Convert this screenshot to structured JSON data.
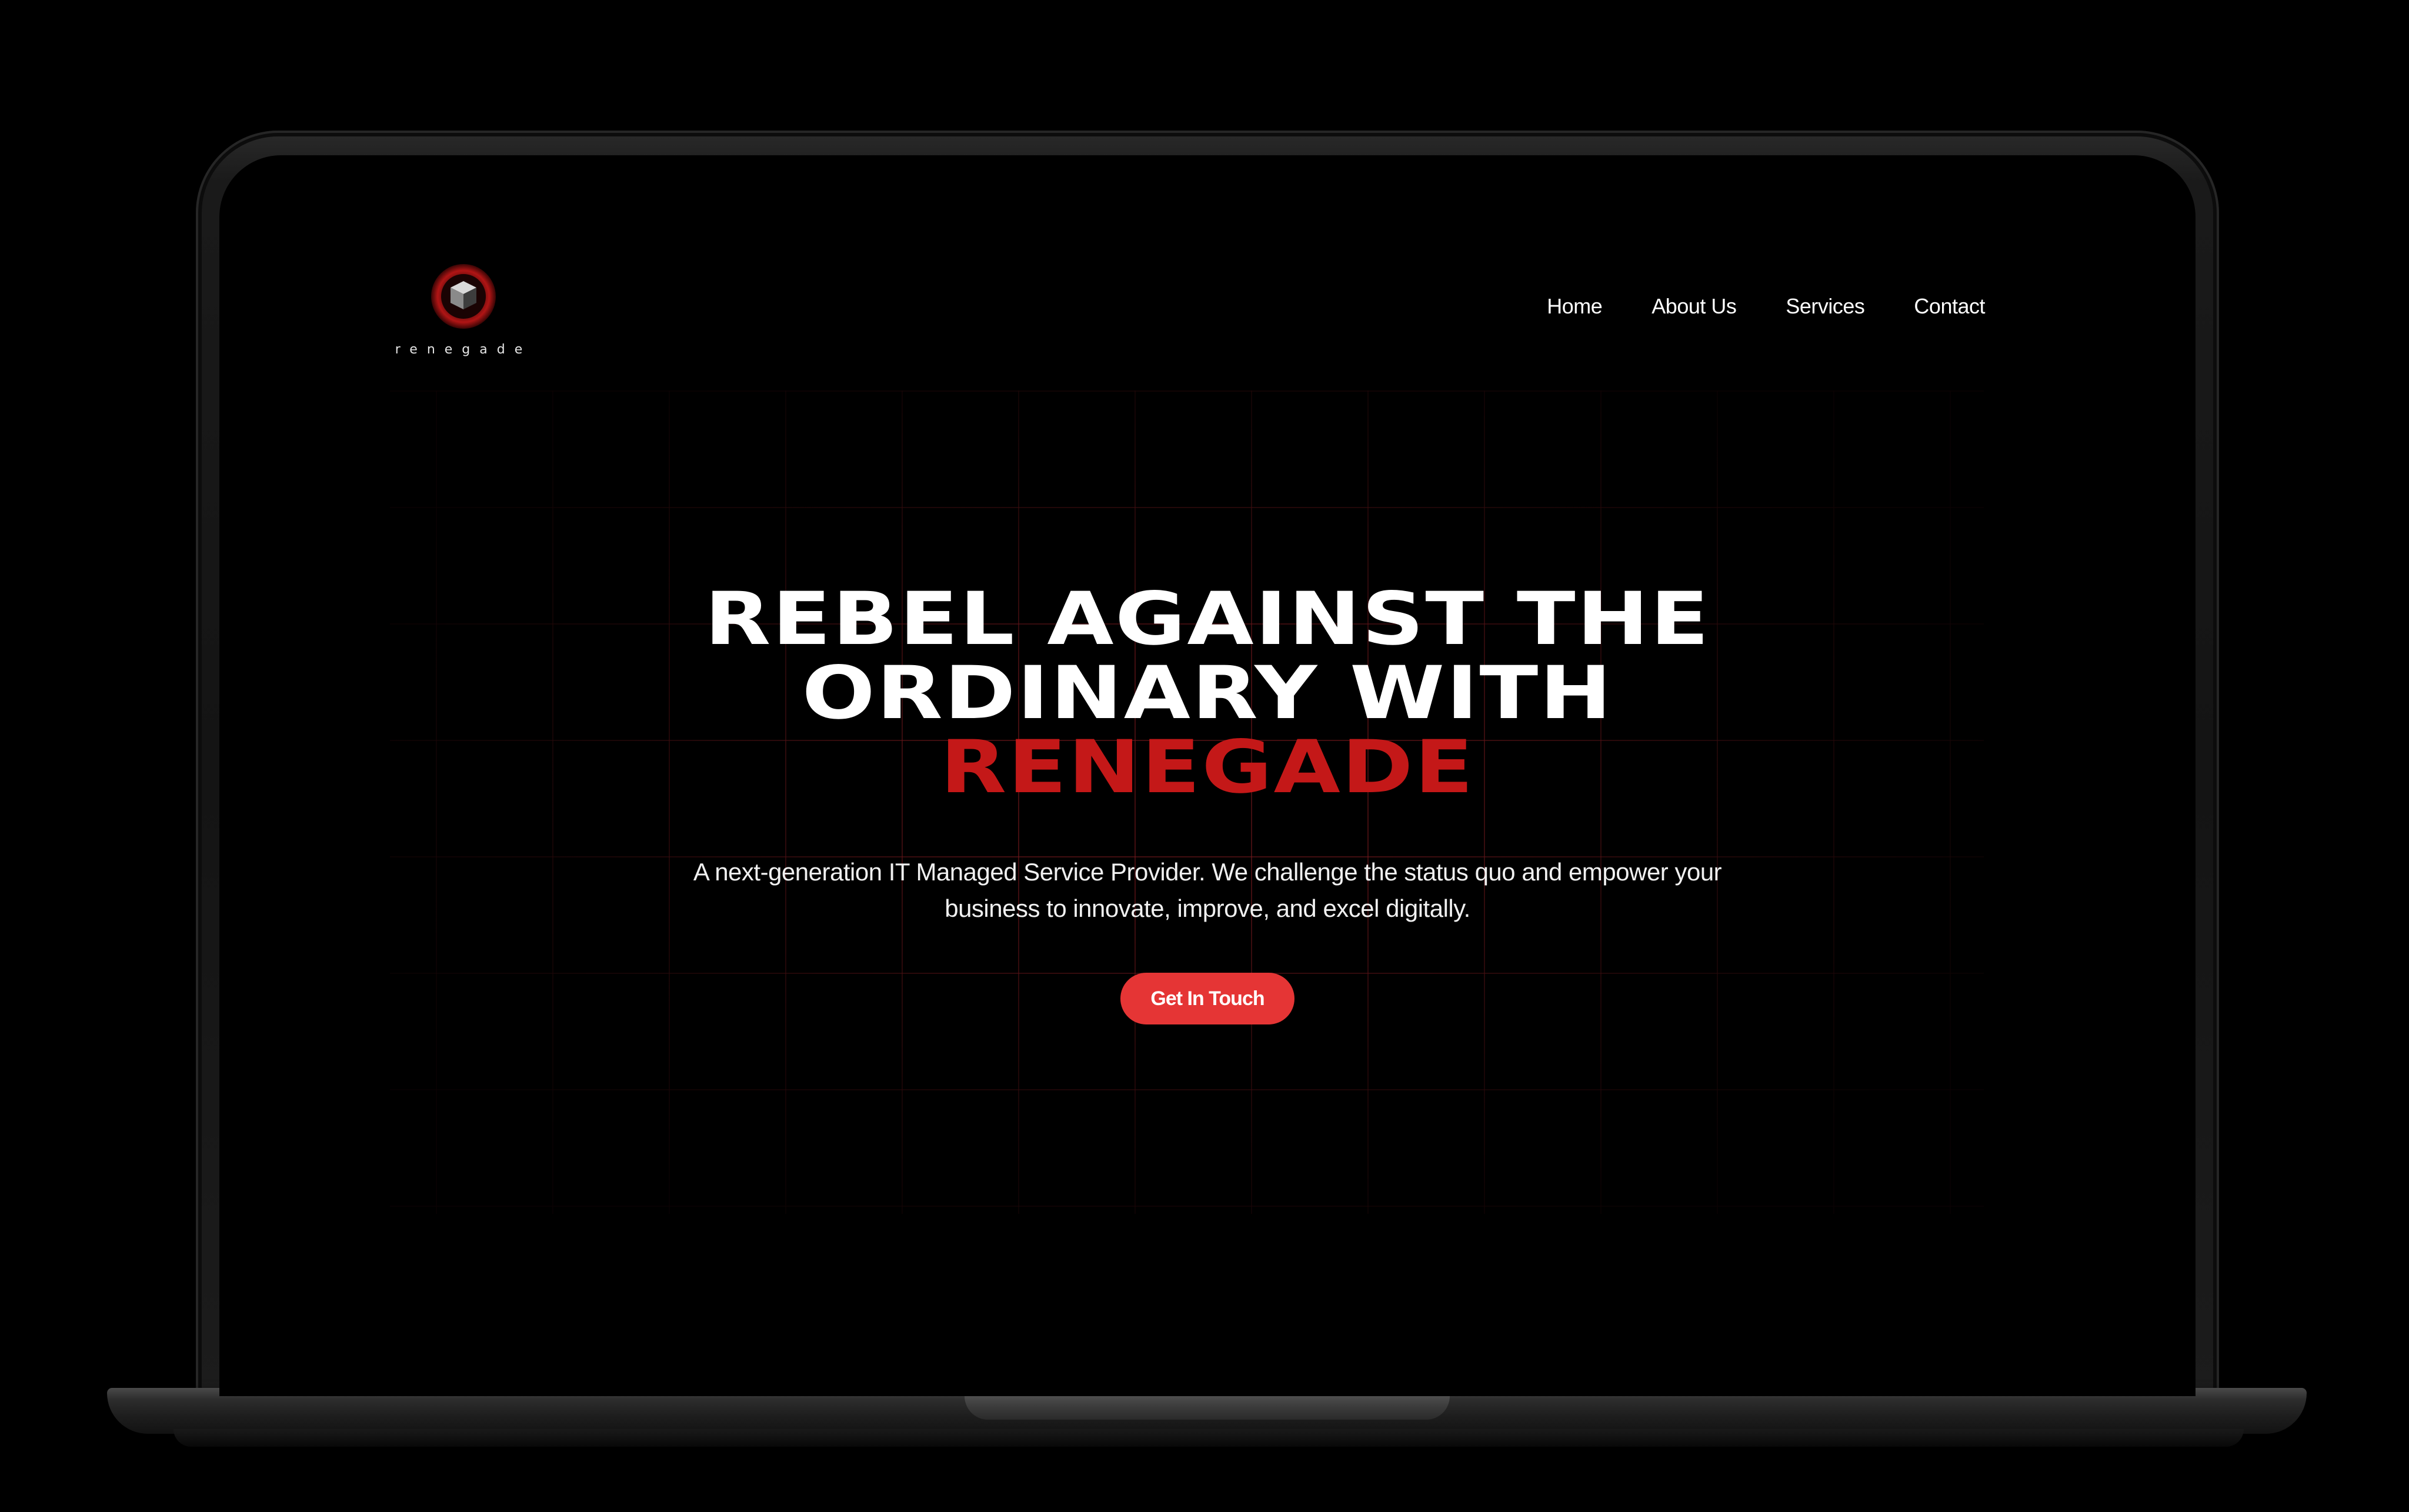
{
  "brand": {
    "name": "renegade"
  },
  "nav": {
    "items": [
      {
        "label": "Home"
      },
      {
        "label": "About Us"
      },
      {
        "label": "Services"
      },
      {
        "label": "Contact"
      }
    ]
  },
  "hero": {
    "headline_line1": "REBEL AGAINST THE",
    "headline_line2": "ORDINARY WITH",
    "headline_accent": "RENEGADE",
    "subtitle": "A next-generation IT Managed Service Provider. We challenge the status quo and empower your business to innovate, improve, and excel digitally.",
    "cta_label": "Get In Touch"
  },
  "colors": {
    "background": "#000000",
    "accent_red": "#c41818",
    "button_red": "#e53535",
    "grid_line": "#781e1e",
    "text": "#ffffff"
  }
}
